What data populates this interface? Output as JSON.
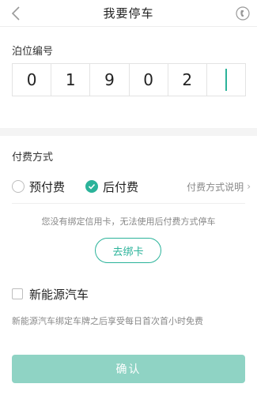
{
  "header": {
    "title": "我要停车",
    "back_icon": "chevron-left-icon",
    "phone_icon": "phone-icon"
  },
  "berth": {
    "label": "泊位编号",
    "digits": [
      "0",
      "1",
      "9",
      "0",
      "2",
      ""
    ]
  },
  "payment": {
    "label": "付费方式",
    "options": [
      {
        "label": "预付费",
        "checked": false
      },
      {
        "label": "后付费",
        "checked": true
      }
    ],
    "explain_label": "付费方式说明",
    "notice": "您没有绑定信用卡，无法使用后付费方式停车",
    "bind_button_label": "去绑卡"
  },
  "new_energy": {
    "label": "新能源汽车",
    "checked": false,
    "note": "新能源汽车绑定车牌之后享受每日首次首小时免费"
  },
  "confirm_label": "确认",
  "colors": {
    "accent": "#2bb39a",
    "confirm_disabled": "#8fd3c4"
  }
}
